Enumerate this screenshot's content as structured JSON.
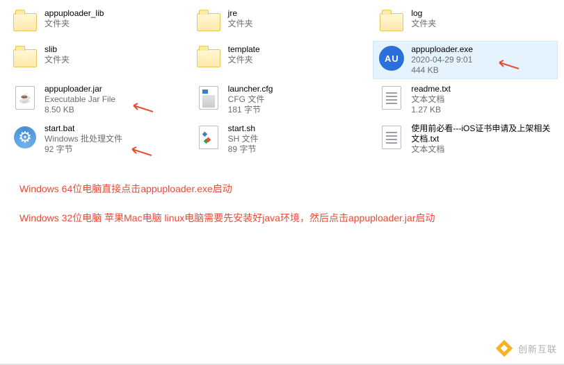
{
  "files": [
    {
      "name": "appuploader_lib",
      "type": "文件夹",
      "size": ""
    },
    {
      "name": "jre",
      "type": "文件夹",
      "size": ""
    },
    {
      "name": "log",
      "type": "文件夹",
      "size": ""
    },
    {
      "name": "slib",
      "type": "文件夹",
      "size": ""
    },
    {
      "name": "template",
      "type": "文件夹",
      "size": ""
    },
    {
      "name": "appuploader.exe",
      "date": "2020-04-29 9:01",
      "size": "444 KB"
    },
    {
      "name": "appuploader.jar",
      "type": "Executable Jar File",
      "size": "8.50 KB"
    },
    {
      "name": "launcher.cfg",
      "type": "CFG 文件",
      "size": "181 字节"
    },
    {
      "name": "readme.txt",
      "type": "文本文档",
      "size": "1.27 KB"
    },
    {
      "name": "start.bat",
      "type": "Windows 批处理文件",
      "size": "92 字节"
    },
    {
      "name": "start.sh",
      "type": "SH 文件",
      "size": "89 字节"
    },
    {
      "name": "使用前必看---iOS证书申请及上架相关文档.txt",
      "type": "文本文档",
      "size": ""
    }
  ],
  "au_label": "AU",
  "arrow_color": "#e94b35",
  "instructions": {
    "line1": "Windows 64位电脑直接点击appuploader.exe启动",
    "line2": "Windows 32位电脑 苹果Mac电脑 linux电脑需要先安装好java环境，然后点击appuploader.jar启动"
  },
  "watermark_text": "创新互联"
}
